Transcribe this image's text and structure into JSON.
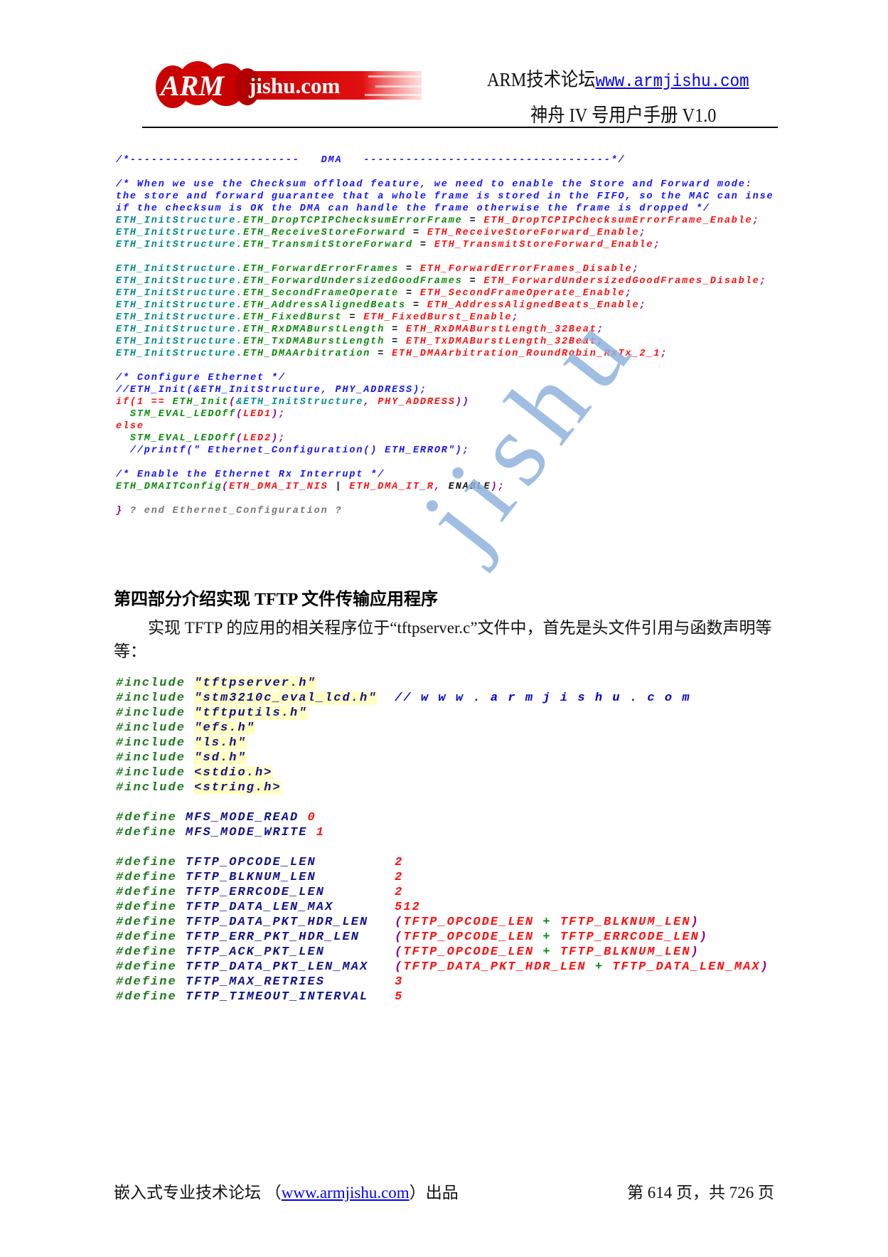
{
  "header": {
    "logo_text": "ARM jishu.com",
    "forum_label": "ARM技术论坛",
    "forum_url": "www.armjishu.com",
    "manual_title": "神舟 IV 号用户手册 V1.0"
  },
  "colors": {
    "c": "#1414ff",
    "t": "#008b8b",
    "g": "#0a8a0a",
    "r": "#ff1010",
    "k": "#111111",
    "p": "#8b008b",
    "n": "#12128a",
    "d": "#1e7a1e",
    "m": "#777777",
    "w": "#0000cc"
  },
  "code_block_1": [
    [
      [
        "c",
        "/*------------------------   DMA   -----------------------------------*/"
      ]
    ],
    [],
    [
      [
        "c",
        "/* When we use the Checksum offload feature, we need to enable the Store and Forward mode:"
      ]
    ],
    [
      [
        "c",
        "the store and forward guarantee that a whole frame is stored in the FIFO, so the MAC can inse"
      ]
    ],
    [
      [
        "c",
        "if the checksum is OK the DMA can handle the frame otherwise the frame is dropped */"
      ]
    ],
    [
      [
        "t",
        "ETH_InitStructure."
      ],
      [
        "g",
        "ETH_DropTCPIPChecksumErrorFrame"
      ],
      [
        "k",
        " = "
      ],
      [
        "r",
        "ETH_DropTCPIPChecksumErrorFrame_Enable"
      ],
      [
        "p",
        ";"
      ]
    ],
    [
      [
        "t",
        "ETH_InitStructure."
      ],
      [
        "g",
        "ETH_ReceiveStoreForward"
      ],
      [
        "k",
        " = "
      ],
      [
        "r",
        "ETH_ReceiveStoreForward_Enable"
      ],
      [
        "p",
        ";"
      ]
    ],
    [
      [
        "t",
        "ETH_InitStructure."
      ],
      [
        "g",
        "ETH_TransmitStoreForward"
      ],
      [
        "k",
        " = "
      ],
      [
        "r",
        "ETH_TransmitStoreForward_Enable"
      ],
      [
        "p",
        ";"
      ]
    ],
    [],
    [
      [
        "t",
        "ETH_InitStructure."
      ],
      [
        "g",
        "ETH_ForwardErrorFrames"
      ],
      [
        "k",
        " = "
      ],
      [
        "r",
        "ETH_ForwardErrorFrames_Disable"
      ],
      [
        "p",
        ";"
      ]
    ],
    [
      [
        "t",
        "ETH_InitStructure."
      ],
      [
        "g",
        "ETH_ForwardUndersizedGoodFrames"
      ],
      [
        "k",
        " = "
      ],
      [
        "r",
        "ETH_ForwardUndersizedGoodFrames_Disable"
      ],
      [
        "p",
        ";"
      ]
    ],
    [
      [
        "t",
        "ETH_InitStructure."
      ],
      [
        "g",
        "ETH_SecondFrameOperate"
      ],
      [
        "k",
        " = "
      ],
      [
        "r",
        "ETH_SecondFrameOperate_Enable"
      ],
      [
        "p",
        ";"
      ]
    ],
    [
      [
        "t",
        "ETH_InitStructure."
      ],
      [
        "g",
        "ETH_AddressAlignedBeats"
      ],
      [
        "k",
        " = "
      ],
      [
        "r",
        "ETH_AddressAlignedBeats_Enable"
      ],
      [
        "p",
        ";"
      ]
    ],
    [
      [
        "t",
        "ETH_InitStructure."
      ],
      [
        "g",
        "ETH_FixedBurst"
      ],
      [
        "k",
        " = "
      ],
      [
        "r",
        "ETH_FixedBurst_Enable"
      ],
      [
        "p",
        ";"
      ]
    ],
    [
      [
        "t",
        "ETH_InitStructure."
      ],
      [
        "g",
        "ETH_RxDMABurstLength"
      ],
      [
        "k",
        " = "
      ],
      [
        "r",
        "ETH_RxDMABurstLength_32Beat"
      ],
      [
        "p",
        ";"
      ]
    ],
    [
      [
        "t",
        "ETH_InitStructure."
      ],
      [
        "g",
        "ETH_TxDMABurstLength"
      ],
      [
        "k",
        " = "
      ],
      [
        "r",
        "ETH_TxDMABurstLength_32Beat"
      ],
      [
        "p",
        ";"
      ]
    ],
    [
      [
        "t",
        "ETH_InitStructure."
      ],
      [
        "g",
        "ETH_DMAArbitration"
      ],
      [
        "k",
        " = "
      ],
      [
        "r",
        "ETH_DMAArbitration_RoundRobin_RxTx_2_1"
      ],
      [
        "p",
        ";"
      ]
    ],
    [],
    [
      [
        "c",
        "/* Configure Ethernet */"
      ]
    ],
    [
      [
        "c",
        "//ETH_Init(&ETH_InitStructure, PHY_ADDRESS);"
      ]
    ],
    [
      [
        "r",
        "if(1 == "
      ],
      [
        "g",
        "ETH_Init"
      ],
      [
        "p",
        "("
      ],
      [
        "t",
        "&ETH_InitStructure"
      ],
      [
        "p",
        ", "
      ],
      [
        "r",
        "PHY_ADDRESS"
      ],
      [
        "p",
        "))"
      ]
    ],
    [
      [
        "k",
        "  "
      ],
      [
        "g",
        "STM_EVAL_LEDOff"
      ],
      [
        "p",
        "("
      ],
      [
        "r",
        "LED1"
      ],
      [
        "p",
        ");"
      ]
    ],
    [
      [
        "r",
        "else"
      ]
    ],
    [
      [
        "k",
        "  "
      ],
      [
        "g",
        "STM_EVAL_LEDOff"
      ],
      [
        "p",
        "("
      ],
      [
        "r",
        "LED2"
      ],
      [
        "p",
        ");"
      ]
    ],
    [
      [
        "k",
        "  "
      ],
      [
        "c",
        "//printf(\" Ethernet_Configuration() ETH_ERROR\");"
      ]
    ],
    [],
    [
      [
        "c",
        "/* Enable the Ethernet Rx Interrupt */"
      ]
    ],
    [
      [
        "g",
        "ETH_DMAITConfig"
      ],
      [
        "p",
        "("
      ],
      [
        "r",
        "ETH_DMA_IT_NIS"
      ],
      [
        "k",
        " | "
      ],
      [
        "r",
        "ETH_DMA_IT_R"
      ],
      [
        "p",
        ", "
      ],
      [
        "k",
        "ENABLE"
      ],
      [
        "p",
        ");"
      ]
    ],
    [],
    [
      [
        "p",
        "} "
      ],
      [
        "m",
        "? end Ethernet_Configuration ?"
      ]
    ]
  ],
  "section": {
    "heading": "第四部分介绍实现 TFTP 文件传输应用程序",
    "paragraph": "实现 TFTP 的应用的相关程序位于“tftpserver.c”文件中，首先是头文件引用与函数声明等等："
  },
  "code_block_2": [
    [
      [
        "d",
        "#include "
      ],
      [
        "n",
        "\"tftpserver.h\"",
        "hl"
      ]
    ],
    [
      [
        "d",
        "#include "
      ],
      [
        "n",
        "\"stm3210c_eval_lcd.h\"",
        "hl"
      ],
      [
        "k",
        "  "
      ],
      [
        "w",
        "// w w w . a r m j i s h u . c o m"
      ]
    ],
    [
      [
        "d",
        "#include "
      ],
      [
        "n",
        "\"tftputils.h\"",
        "hl"
      ]
    ],
    [
      [
        "d",
        "#include "
      ],
      [
        "n",
        "\"efs.h\"",
        "hl"
      ]
    ],
    [
      [
        "d",
        "#include "
      ],
      [
        "n",
        "\"ls.h\"",
        "hl"
      ]
    ],
    [
      [
        "d",
        "#include "
      ],
      [
        "n",
        "\"sd.h\"",
        "hl"
      ]
    ],
    [
      [
        "d",
        "#include "
      ],
      [
        "n",
        "<stdio.h>",
        "hl"
      ]
    ],
    [
      [
        "d",
        "#include "
      ],
      [
        "n",
        "<string.h>",
        "hl"
      ]
    ],
    [],
    [
      [
        "d",
        "#define "
      ],
      [
        "n",
        "MFS_MODE_READ "
      ],
      [
        "r",
        "0"
      ]
    ],
    [
      [
        "d",
        "#define "
      ],
      [
        "n",
        "MFS_MODE_WRITE "
      ],
      [
        "r",
        "1"
      ]
    ],
    [],
    [
      [
        "d",
        "#define "
      ],
      [
        "n",
        "TFTP_OPCODE_LEN         "
      ],
      [
        "r",
        "2"
      ]
    ],
    [
      [
        "d",
        "#define "
      ],
      [
        "n",
        "TFTP_BLKNUM_LEN         "
      ],
      [
        "r",
        "2"
      ]
    ],
    [
      [
        "d",
        "#define "
      ],
      [
        "n",
        "TFTP_ERRCODE_LEN        "
      ],
      [
        "r",
        "2"
      ]
    ],
    [
      [
        "d",
        "#define "
      ],
      [
        "n",
        "TFTP_DATA_LEN_MAX       "
      ],
      [
        "r",
        "512"
      ]
    ],
    [
      [
        "d",
        "#define "
      ],
      [
        "n",
        "TFTP_DATA_PKT_HDR_LEN   "
      ],
      [
        "p",
        "("
      ],
      [
        "r",
        "TFTP_OPCODE_LEN"
      ],
      [
        "g",
        " + "
      ],
      [
        "r",
        "TFTP_BLKNUM_LEN"
      ],
      [
        "p",
        ")"
      ]
    ],
    [
      [
        "d",
        "#define "
      ],
      [
        "n",
        "TFTP_ERR_PKT_HDR_LEN    "
      ],
      [
        "p",
        "("
      ],
      [
        "r",
        "TFTP_OPCODE_LEN"
      ],
      [
        "g",
        " + "
      ],
      [
        "r",
        "TFTP_ERRCODE_LEN"
      ],
      [
        "p",
        ")"
      ]
    ],
    [
      [
        "d",
        "#define "
      ],
      [
        "n",
        "TFTP_ACK_PKT_LEN        "
      ],
      [
        "p",
        "("
      ],
      [
        "r",
        "TFTP_OPCODE_LEN"
      ],
      [
        "g",
        " + "
      ],
      [
        "r",
        "TFTP_BLKNUM_LEN"
      ],
      [
        "p",
        ")"
      ]
    ],
    [
      [
        "d",
        "#define "
      ],
      [
        "n",
        "TFTP_DATA_PKT_LEN_MAX   "
      ],
      [
        "p",
        "("
      ],
      [
        "r",
        "TFTP_DATA_PKT_HDR_LEN"
      ],
      [
        "g",
        " + "
      ],
      [
        "r",
        "TFTP_DATA_LEN_MAX"
      ],
      [
        "p",
        ")"
      ]
    ],
    [
      [
        "d",
        "#define "
      ],
      [
        "n",
        "TFTP_MAX_RETRIES        "
      ],
      [
        "r",
        "3"
      ]
    ],
    [
      [
        "d",
        "#define "
      ],
      [
        "n",
        "TFTP_TIMEOUT_INTERVAL   "
      ],
      [
        "r",
        "5"
      ]
    ]
  ],
  "watermark": "jishu",
  "footer": {
    "left_prefix": "嵌入式专业技术论坛 （",
    "url": "www.armjishu.com",
    "left_suffix": "）出品",
    "page_info": "第 614 页，共 726 页"
  }
}
